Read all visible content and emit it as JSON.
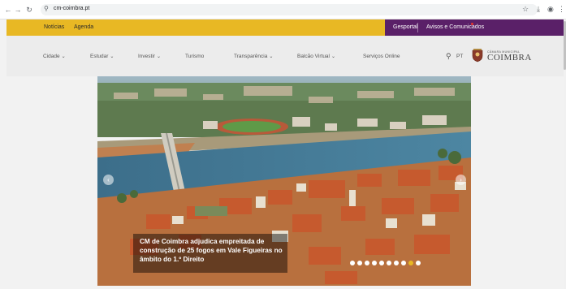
{
  "browser": {
    "url": "cm-coimbra.pt",
    "back_icon": "arrow-left-icon",
    "forward_icon": "arrow-right-icon",
    "reload_icon": "reload-icon",
    "bookmark_icon": "star-icon",
    "download_icon": "download-icon",
    "menu_icon": "kebab-menu-icon"
  },
  "topbar": {
    "links": [
      "Notícias",
      "Agenda"
    ],
    "right_links": [
      "Gesportal",
      "Avisos e Comunicados"
    ],
    "accent_color": "#e8b824",
    "purple_color": "#5a2068"
  },
  "mainnav": {
    "items": [
      {
        "label": "Cidade",
        "dropdown": true
      },
      {
        "label": "Estudar",
        "dropdown": true
      },
      {
        "label": "Investir",
        "dropdown": true
      },
      {
        "label": "Turismo",
        "dropdown": false
      },
      {
        "label": "Transparência",
        "dropdown": true
      },
      {
        "label": "Balcão Virtual",
        "dropdown": true
      },
      {
        "label": "Serviços Online",
        "dropdown": false
      }
    ],
    "lang": "PT",
    "brand_small": "CÂMARA MUNICIPAL",
    "brand": "COIMBRA"
  },
  "hero": {
    "caption": "CM de Coimbra adjudica empreitada de construção de 25 fogos em Vale Figueiras no âmbito do 1.º Direito",
    "slide_count": 10,
    "active_slide": 8
  }
}
